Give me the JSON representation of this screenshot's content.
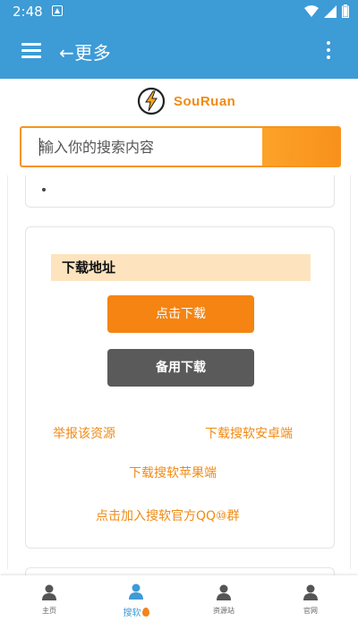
{
  "status_bar": {
    "time": "2:48"
  },
  "app_bar": {
    "title": "←更多"
  },
  "logo": {
    "text": "SouRuan"
  },
  "search": {
    "placeholder": "输入你的搜索内容"
  },
  "download_section": {
    "title": "下载地址",
    "primary_button": "点击下载",
    "secondary_button": "备用下载",
    "links": {
      "report": "举报该资源",
      "android": "下载搜软安卓端",
      "ios": "下载搜软苹果端",
      "qq_group": "点击加入搜软官方QQ⑩群"
    }
  },
  "bottom_nav": {
    "items": [
      {
        "label": "主页",
        "icon": "person-icon"
      },
      {
        "label": "搜软",
        "icon": "person-icon",
        "active": true
      },
      {
        "label": "资源站",
        "icon": "person-icon"
      },
      {
        "label": "官网",
        "icon": "person-icon"
      }
    ]
  },
  "colors": {
    "primary_blue": "#3d9bd6",
    "accent_orange": "#f58412",
    "title_bg": "#fde4bf",
    "secondary_button": "#5a5a5a"
  }
}
